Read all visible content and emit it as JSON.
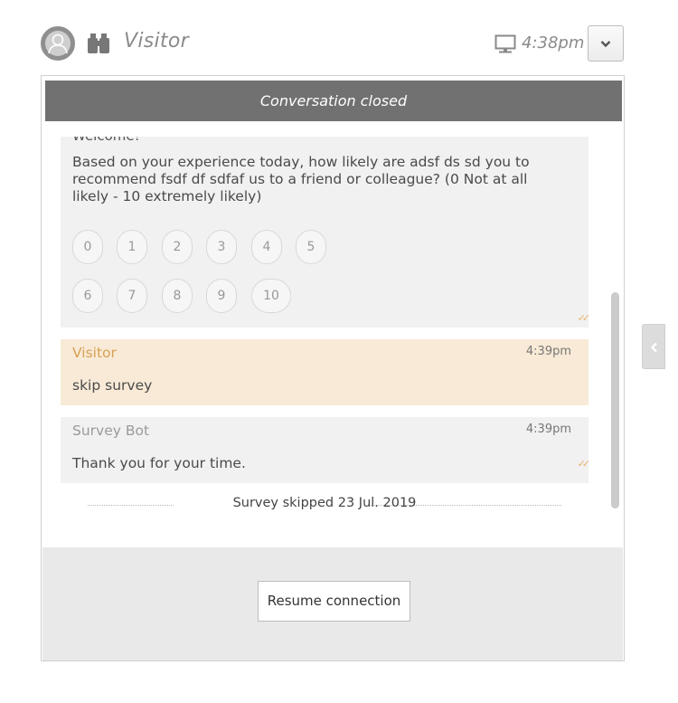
{
  "header": {
    "visitor_name": "Visitor",
    "time": "4:38pm",
    "icons": {
      "avatar": "user-avatar-icon",
      "binoculars": "binoculars-icon",
      "monitor": "monitor-icon",
      "dropdown": "chevron-down-icon"
    }
  },
  "status_bar": {
    "label": "Conversation closed"
  },
  "chat": {
    "survey_message": {
      "cut_off_text": "Welcome!",
      "question": "Based on your experience today, how likely are adsf ds sd you to recommend fsdf df sdfaf us to a friend or colleague? (0 Not at all likely - 10 extremely likely)",
      "options": [
        "0",
        "1",
        "2",
        "3",
        "4",
        "5",
        "6",
        "7",
        "8",
        "9",
        "10"
      ]
    },
    "messages": [
      {
        "sender": "Visitor",
        "time": "4:39pm",
        "text": "skip survey",
        "type": "visitor"
      },
      {
        "sender": "Survey Bot",
        "time": "4:39pm",
        "text": "Thank you for your time.",
        "type": "bot"
      }
    ],
    "system_note": "Survey skipped 23 Jul. 2019"
  },
  "footer": {
    "resume_label": "Resume connection"
  },
  "side_toggle": {
    "icon": "chevron-left-icon"
  },
  "colors": {
    "status_bar_bg": "#717171",
    "visitor_bubble": "#f8ead6",
    "bot_bubble": "#f1f1f1",
    "visitor_accent": "#d6a155"
  }
}
